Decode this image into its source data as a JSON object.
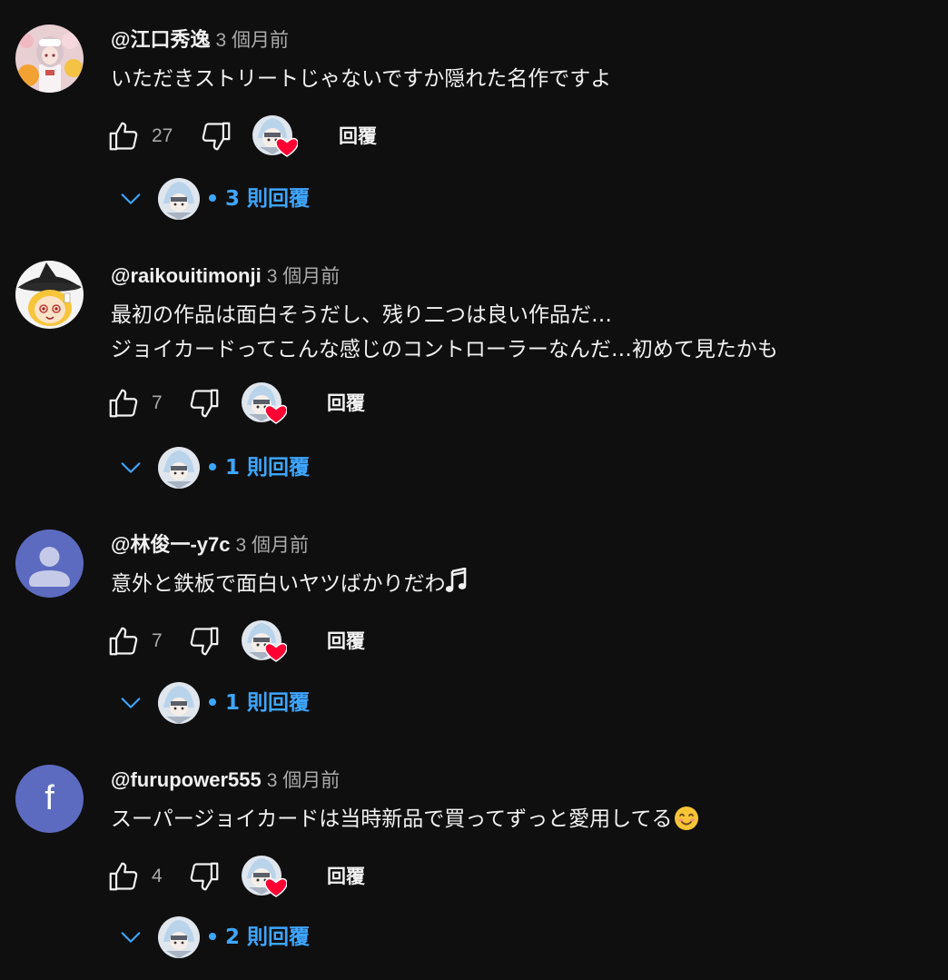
{
  "comments": [
    {
      "handle": "@江口秀逸",
      "time": "3 個月前",
      "lines": [
        "いただきストリートじゃないですか隠れた名作ですよ"
      ],
      "likes": "27",
      "reply_label": "回覆",
      "replies_label": "3 則回覆",
      "avatar_icon": "anime-girl-avatar"
    },
    {
      "handle": "@raikouitimonji",
      "time": "3 個月前",
      "lines": [
        "最初の作品は面白そうだし、残り二つは良い作品だ…",
        "ジョイカードってこんな感じのコントローラーなんだ…初めて見たかも"
      ],
      "likes": "7",
      "reply_label": "回覆",
      "replies_label": "1 則回覆",
      "avatar_icon": "yukkuri-marisa-avatar"
    },
    {
      "handle": "@林俊一-y7c",
      "time": "3 個月前",
      "lines": [
        "意外と鉄板で面白いヤツばかりだわ"
      ],
      "likes": "7",
      "reply_label": "回覆",
      "replies_label": "1 則回覆",
      "avatar_icon": "default-person-avatar",
      "line_emoji": "musical-note-emoji"
    },
    {
      "handle": "@furupower555",
      "time": "3 個月前",
      "lines": [
        "スーパージョイカードは当時新品で買ってずっと愛用してる"
      ],
      "likes": "4",
      "reply_label": "回覆",
      "replies_label": "2 則回覆",
      "avatar_icon": "letter-avatar",
      "avatar_letter": "f",
      "line_emoji": "smiling-face-emoji"
    }
  ],
  "colors": {
    "background": "#0f0f0f",
    "text": "#f1f1f1",
    "secondary": "#aaaaaa",
    "accent_blue": "#3ea6ff",
    "heart_red": "#ff0033",
    "avatar_purple": "#5c6bc0"
  }
}
